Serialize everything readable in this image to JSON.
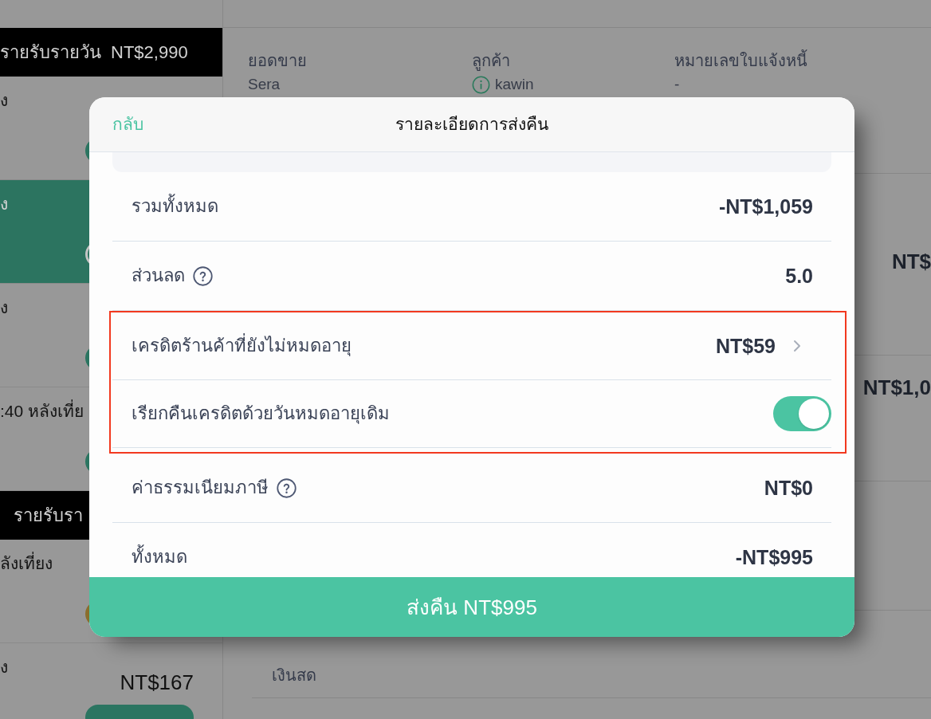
{
  "sidebar": {
    "groups": [
      {
        "title": "รายรับรายวัน",
        "total": "NT$2,990",
        "orders": [
          {
            "time": "ง",
            "selected": false,
            "color": "#2b7561"
          },
          {
            "time": "ง",
            "selected": true,
            "color": "#c4c4c4"
          },
          {
            "time": "ง",
            "selected": false,
            "color": "#2b7561"
          },
          {
            "time": ":40 หลังเที่ย",
            "selected": false,
            "color": "#2b7561"
          }
        ]
      },
      {
        "title": "รายรับรา",
        "orders": [
          {
            "time": "ลังเที่ยง",
            "selected": false,
            "color": "#8a6e2c"
          },
          {
            "time": "ง",
            "selected": false,
            "color": "#2b7561",
            "amount": "NT$167"
          }
        ]
      }
    ]
  },
  "order": {
    "fields": [
      {
        "kind": "plain",
        "label": "ยอดขาย",
        "value": "Sera"
      },
      {
        "kind": "customer",
        "label": "ลูกค้า",
        "value": "kawin"
      },
      {
        "kind": "plain",
        "label": "หมายเลขใบแจ้งหนี้",
        "value": "-"
      }
    ],
    "items": [
      {
        "amount": "NT$"
      },
      {
        "amount": "NT$1,0"
      }
    ],
    "payment_method": "เงินสด"
  },
  "dialog": {
    "back": "กลับ",
    "title": "รายละเอียดการส่งคืน",
    "rows": [
      {
        "kind": "total",
        "label": "รวมทั้งหมด",
        "value": "-NT$1,059",
        "highlighted": false
      },
      {
        "kind": "help",
        "label": "ส่วนลด",
        "value": "5.0",
        "highlighted": false
      },
      {
        "kind": "link",
        "label": "เครดิตร้านค้าที่ยังไม่หมดอายุ",
        "value": "NT$59",
        "highlighted": true
      },
      {
        "kind": "toggle",
        "label": "เรียกคืนเครดิตด้วยวันหมดอายุเดิม",
        "on": true,
        "highlighted": true
      },
      {
        "kind": "help",
        "label": "ค่าธรรมเนียมภาษี",
        "value": "NT$0",
        "highlighted": false
      },
      {
        "kind": "total",
        "label": "ทั้งหมด",
        "value": "-NT$995",
        "highlighted": false
      }
    ],
    "submit": "ส่งคืน NT$995"
  }
}
